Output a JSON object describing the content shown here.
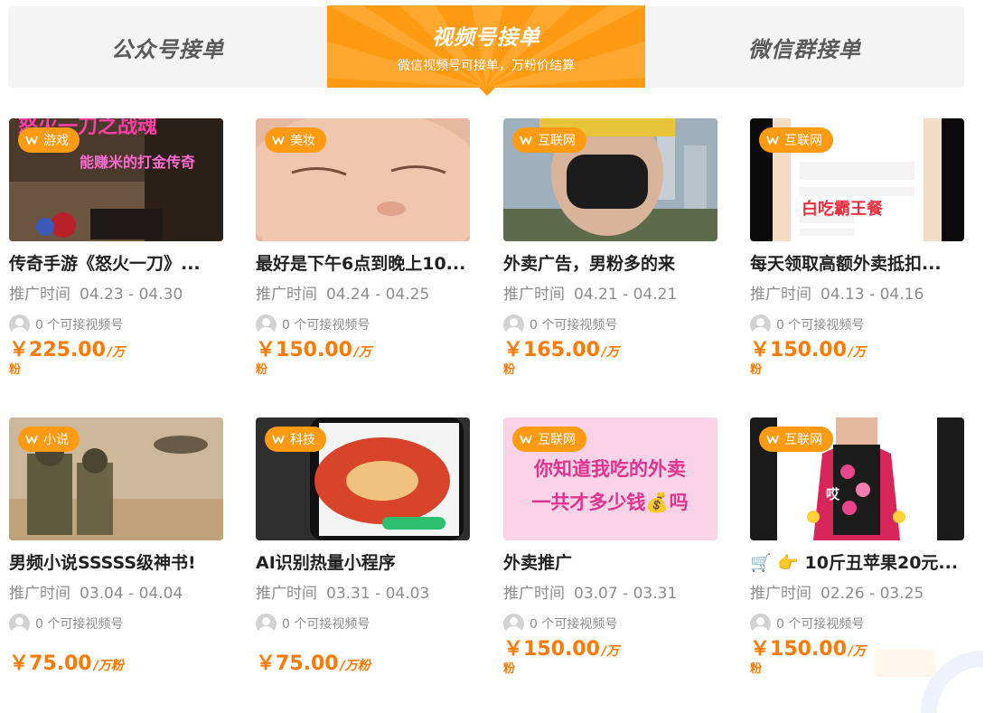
{
  "tabs": [
    {
      "title": "公众号接单",
      "subtitle": ""
    },
    {
      "title": "视频号接单",
      "subtitle": "微信视频号可接单，万粉价结算"
    },
    {
      "title": "微信群接单",
      "subtitle": ""
    }
  ],
  "labels": {
    "date_label": "推广时间",
    "available": "0 个可接视频号",
    "currency": "￥"
  },
  "colors": {
    "accent": "#ff9a13",
    "price": "#ff7a00"
  },
  "cards": [
    {
      "tag": "游戏",
      "thumb_text": [
        "怒火一刀之战魂",
        "能赚米的打金传奇"
      ],
      "title": "传奇手游《怒火一刀》...",
      "date": "04.23 - 04.30",
      "price": "225.00",
      "unit_a": "/万",
      "unit_b": "粉"
    },
    {
      "tag": "美妆",
      "thumb_text": [],
      "title": "最好是下午6点到晚上10...",
      "date": "04.24 - 04.25",
      "price": "150.00",
      "unit_a": "/万",
      "unit_b": "粉"
    },
    {
      "tag": "互联网",
      "thumb_text": [],
      "title": "外卖广告，男粉多的来",
      "date": "04.21 - 04.21",
      "price": "165.00",
      "unit_a": "/万",
      "unit_b": "粉"
    },
    {
      "tag": "互联网",
      "thumb_text": [
        "白吃霸王餐"
      ],
      "title": "每天领取高额外卖抵扣...",
      "date": "04.13 - 04.16",
      "price": "150.00",
      "unit_a": "/万",
      "unit_b": "粉"
    },
    {
      "tag": "小说",
      "thumb_text": [],
      "title": "男频小说SSSSS级神书!",
      "date": "03.04 - 04.04",
      "price": "75.00",
      "unit_a": "/万粉",
      "unit_b": ""
    },
    {
      "tag": "科技",
      "thumb_text": [],
      "title": "AI识别热量小程序",
      "date": "03.31 - 04.03",
      "price": "75.00",
      "unit_a": "/万粉",
      "unit_b": ""
    },
    {
      "tag": "互联网",
      "thumb_text": [
        "你知道我吃的外卖",
        "一共才多少钱💰吗"
      ],
      "title": "外卖推广",
      "date": "03.07 - 03.31",
      "price": "150.00",
      "unit_a": "/万",
      "unit_b": "粉"
    },
    {
      "tag": "互联网",
      "thumb_text": [
        "哎"
      ],
      "title": "🛒 👉 10斤丑苹果20元...",
      "date": "02.26 - 03.25",
      "price": "150.00",
      "unit_a": "/万",
      "unit_b": "粉"
    }
  ]
}
